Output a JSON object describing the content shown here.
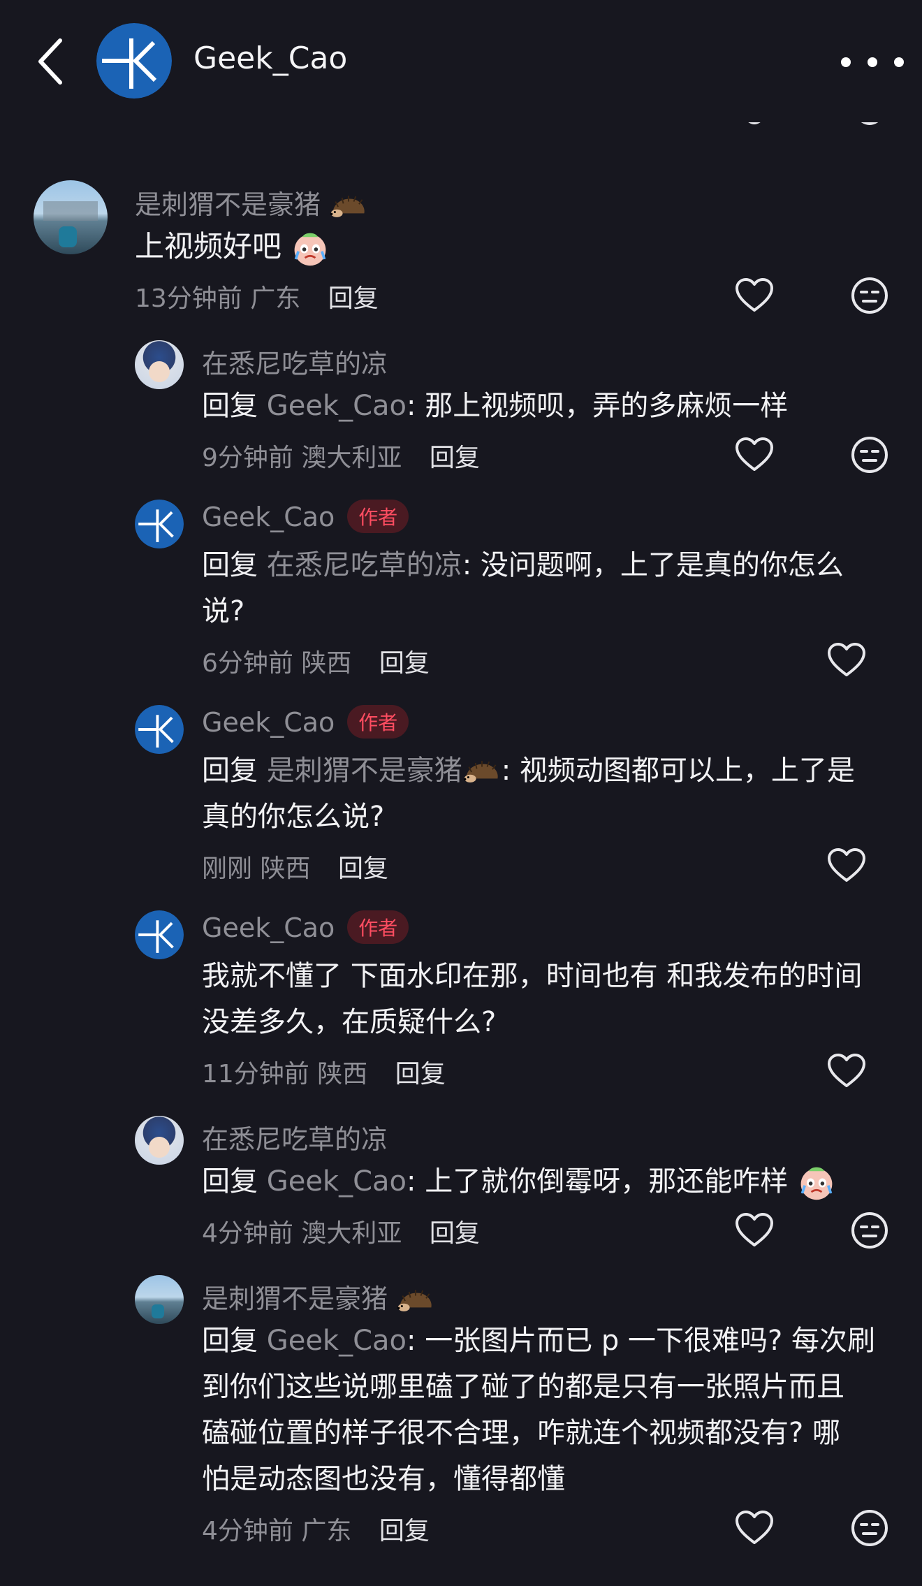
{
  "header": {
    "title": "Geek_Cao"
  },
  "colors": {
    "background": "#17171f",
    "author_badge_bg": "#4a1a22",
    "author_badge_text": "#ff4d61",
    "muted": "#8f8f96"
  },
  "icons": [
    "back-icon",
    "more-icon",
    "heart-icon",
    "emoji-face-icon",
    "hedgehog-emoji",
    "crying-emoji"
  ],
  "comments": [
    {
      "name": "是刺猬不是豪猪",
      "text": "上视频好吧",
      "time": "13分钟前",
      "location": "广东",
      "reply_label": "回复"
    },
    {
      "name": "在悉尼吃草的凉",
      "reply_prefix": "回复",
      "reply_to": "Geek_Cao",
      "text": ": 那上视频呗，弄的多麻烦一样",
      "time": "9分钟前",
      "location": "澳大利亚",
      "reply_label": "回复"
    },
    {
      "name": "Geek_Cao",
      "badge": "作者",
      "reply_prefix": "回复",
      "reply_to": "在悉尼吃草的凉",
      "text_line1": ": 没问题啊，上了是真的你怎么",
      "text_line2": "说?",
      "time": "6分钟前",
      "location": "陕西",
      "reply_label": "回复"
    },
    {
      "name": "Geek_Cao",
      "badge": "作者",
      "reply_prefix": "回复",
      "reply_to": "是刺猬不是豪猪",
      "text_line1": ": 视频动图都可以上，上了是",
      "text_line2": "真的你怎么说?",
      "time": "刚刚",
      "location": "陕西",
      "reply_label": "回复"
    },
    {
      "name": "Geek_Cao",
      "badge": "作者",
      "text_line1": "我就不懂了 下面水印在那，时间也有 和我发布的时间",
      "text_line2": "没差多久，在质疑什么?",
      "time": "11分钟前",
      "location": "陕西",
      "reply_label": "回复"
    },
    {
      "name": "在悉尼吃草的凉",
      "reply_prefix": "回复",
      "reply_to": "Geek_Cao",
      "text": ": 上了就你倒霉呀，那还能咋样",
      "time": "4分钟前",
      "location": "澳大利亚",
      "reply_label": "回复"
    },
    {
      "name": "是刺猬不是豪猪",
      "reply_prefix": "回复",
      "reply_to": "Geek_Cao",
      "text_line1": ": 一张图片而已 p 一下很难吗? 每次刷",
      "text_line2": "到你们这些说哪里磕了碰了的都是只有一张照片而且",
      "text_line3": "磕碰位置的样子很不合理，咋就连个视频都没有? 哪",
      "text_line4": "怕是动态图也没有，懂得都懂",
      "time": "4分钟前",
      "location": "广东",
      "reply_label": "回复"
    }
  ]
}
